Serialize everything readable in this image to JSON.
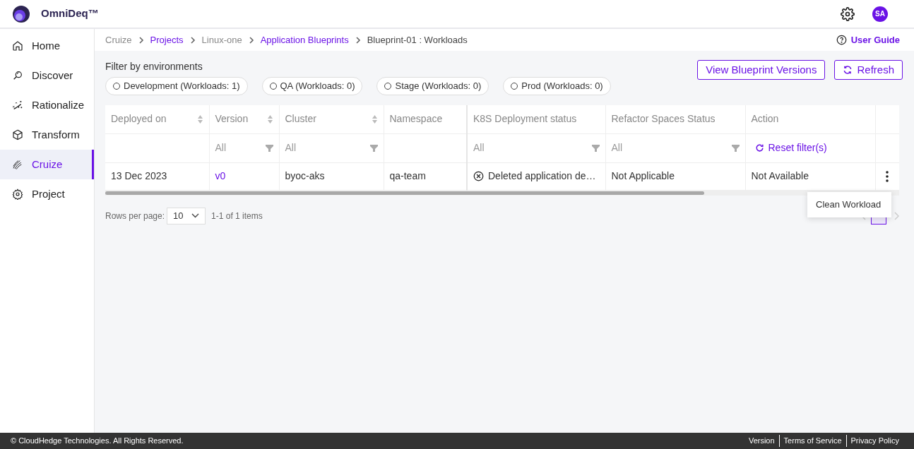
{
  "app": {
    "title": "OmniDeq™",
    "user_initials": "SA"
  },
  "sidebar": {
    "items": [
      {
        "label": "Home",
        "selected": false
      },
      {
        "label": "Discover",
        "selected": false
      },
      {
        "label": "Rationalize",
        "selected": false
      },
      {
        "label": "Transform",
        "selected": false
      },
      {
        "label": "Cruize",
        "selected": true
      },
      {
        "label": "Project",
        "selected": false
      }
    ]
  },
  "breadcrumbs": [
    {
      "label": "Cruize",
      "kind": "plain"
    },
    {
      "label": "Projects",
      "kind": "link"
    },
    {
      "label": "Linux-one",
      "kind": "plain"
    },
    {
      "label": "Application Blueprints",
      "kind": "link"
    },
    {
      "label": "Blueprint-01 : Workloads",
      "kind": "current"
    }
  ],
  "user_guide": "User Guide",
  "filter_label": "Filter by environments",
  "environments": [
    {
      "label": "Development (Workloads: 1)",
      "selected": false
    },
    {
      "label": "QA (Workloads: 0)",
      "selected": false
    },
    {
      "label": "Stage (Workloads: 0)",
      "selected": false
    },
    {
      "label": "Prod (Workloads: 0)",
      "selected": false
    }
  ],
  "buttons": [
    {
      "label": "View Blueprint Versions",
      "kind": "plain"
    },
    {
      "label": "Refresh",
      "kind": "refresh"
    }
  ],
  "table": {
    "columns": [
      {
        "label": "Deployed on",
        "sortable": true
      },
      {
        "label": "Version",
        "sortable": true,
        "filter": "All"
      },
      {
        "label": "Cluster",
        "sortable": true,
        "filter": "All"
      },
      {
        "label": "Namespace",
        "sortable": false
      },
      {
        "label": "K8S Deployment status",
        "sortable": false,
        "filter": "All"
      },
      {
        "label": "Refactor Spaces Status",
        "sortable": false,
        "filter": "All"
      },
      {
        "label": "Action",
        "sortable": false
      }
    ],
    "reset_filters": "Reset filter(s)",
    "rows": [
      {
        "cells": [
          "13 Dec 2023",
          "v0",
          "byoc-aks",
          "qa-team",
          "Deleted application de…",
          "Not Applicable",
          "Not Available"
        ]
      }
    ]
  },
  "pagination": {
    "rows_per_page_label": "Rows per page:",
    "rows_per_page": "10",
    "range": "1-1 of 1 items"
  },
  "row_menu": {
    "items": [
      "Clean Workload"
    ]
  },
  "footer": {
    "copyright": "© CloudHedge Technologies. All Rights Reserved.",
    "links": [
      "Version",
      "Terms of Service",
      "Privacy Policy"
    ]
  }
}
